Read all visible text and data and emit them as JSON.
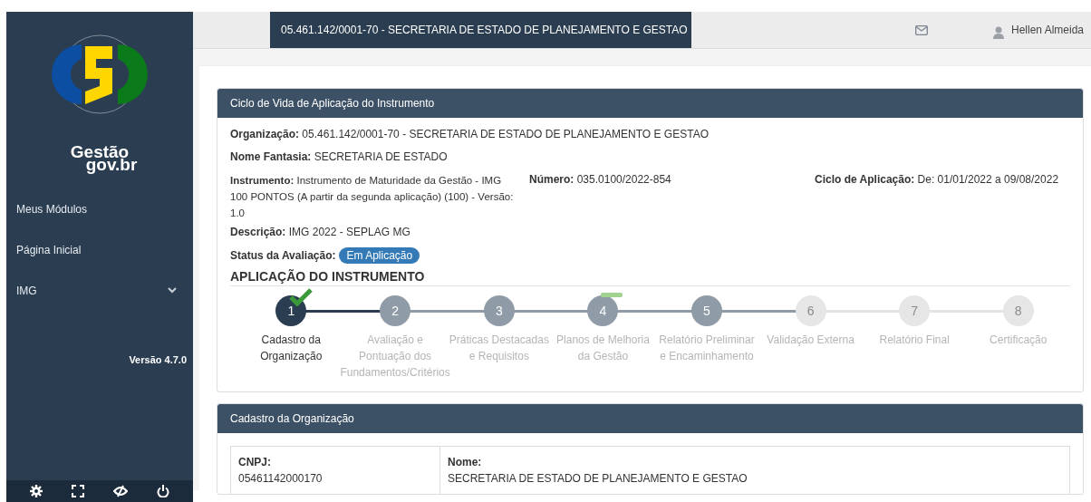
{
  "sidebar": {
    "brand": "Gestão",
    "brand_suffix": "gov.br",
    "items": [
      {
        "label": "Meus Módulos",
        "expandable": false
      },
      {
        "label": "Página Inicial",
        "expandable": false
      },
      {
        "label": "IMG",
        "expandable": true
      }
    ],
    "version": "Versão 4.7.0"
  },
  "topbar": {
    "organization": "05.461.142/0001-70 - SECRETARIA DE ESTADO DE PLANEJAMENTO E GESTAO",
    "user": "Hellen Almeida"
  },
  "lifecycle_card": {
    "title": "Ciclo de Vida de Aplicação do Instrumento",
    "fields": [
      "**Organização:** 05.461.142/0001-70 - SECRETARIA DE ESTADO DE PLANEJAMENTO E GESTAO",
      "**Nome Fantasia:** SECRETARIA DE ESTADO"
    ],
    "instrument_row": [
      "**Instrumento:** Instrumento de Maturidade da Gestão - IMG 100 PONTOS (A partir da segunda aplicação) (100) - Versão: 1.0",
      "**Número:** 035.0100/2022-854",
      "**Ciclo de Aplicação:** De: 01/01/2022 a 09/08/2022"
    ],
    "description": "**Descrição:** IMG 2022 - SEPLAG MG",
    "status_label": "Status da Avaliação:",
    "status": "Em Aplicação",
    "section_title": "APLICAÇÃO DO INSTRUMENTO",
    "steps": [
      {
        "number": "1",
        "label": "Cadastro da Organização",
        "selected": true,
        "disabled": false,
        "checked": true,
        "flagged": false
      },
      {
        "number": "2",
        "label": "Avaliação e Pontuação dos Fundamentos/Critérios",
        "selected": false,
        "disabled": false,
        "checked": false,
        "flagged": false
      },
      {
        "number": "3",
        "label": "Práticas Destacadas e Requisitos",
        "selected": false,
        "disabled": false,
        "checked": false,
        "flagged": false
      },
      {
        "number": "4",
        "label": "Planos de Melhoria da Gestão",
        "selected": false,
        "disabled": false,
        "checked": false,
        "flagged": true
      },
      {
        "number": "5",
        "label": "Relatório Preliminar e Encaminhamento",
        "selected": false,
        "disabled": false,
        "checked": false,
        "flagged": false
      },
      {
        "number": "6",
        "label": "Validação Externa",
        "selected": false,
        "disabled": true,
        "checked": false,
        "flagged": false
      },
      {
        "number": "7",
        "label": "Relatório Final",
        "selected": false,
        "disabled": true,
        "checked": false,
        "flagged": false
      },
      {
        "number": "8",
        "label": "Certificação",
        "selected": false,
        "disabled": true,
        "checked": false,
        "flagged": false
      }
    ]
  },
  "organization_card": {
    "title": "Cadastro da Organização",
    "cells": [
      {
        "label": "CNPJ:",
        "value": "05461142000170"
      },
      {
        "label": "Nome:",
        "value": "SECRETARIA DE ESTADO DE PLANEJAMENTO E GESTAO"
      }
    ]
  }
}
